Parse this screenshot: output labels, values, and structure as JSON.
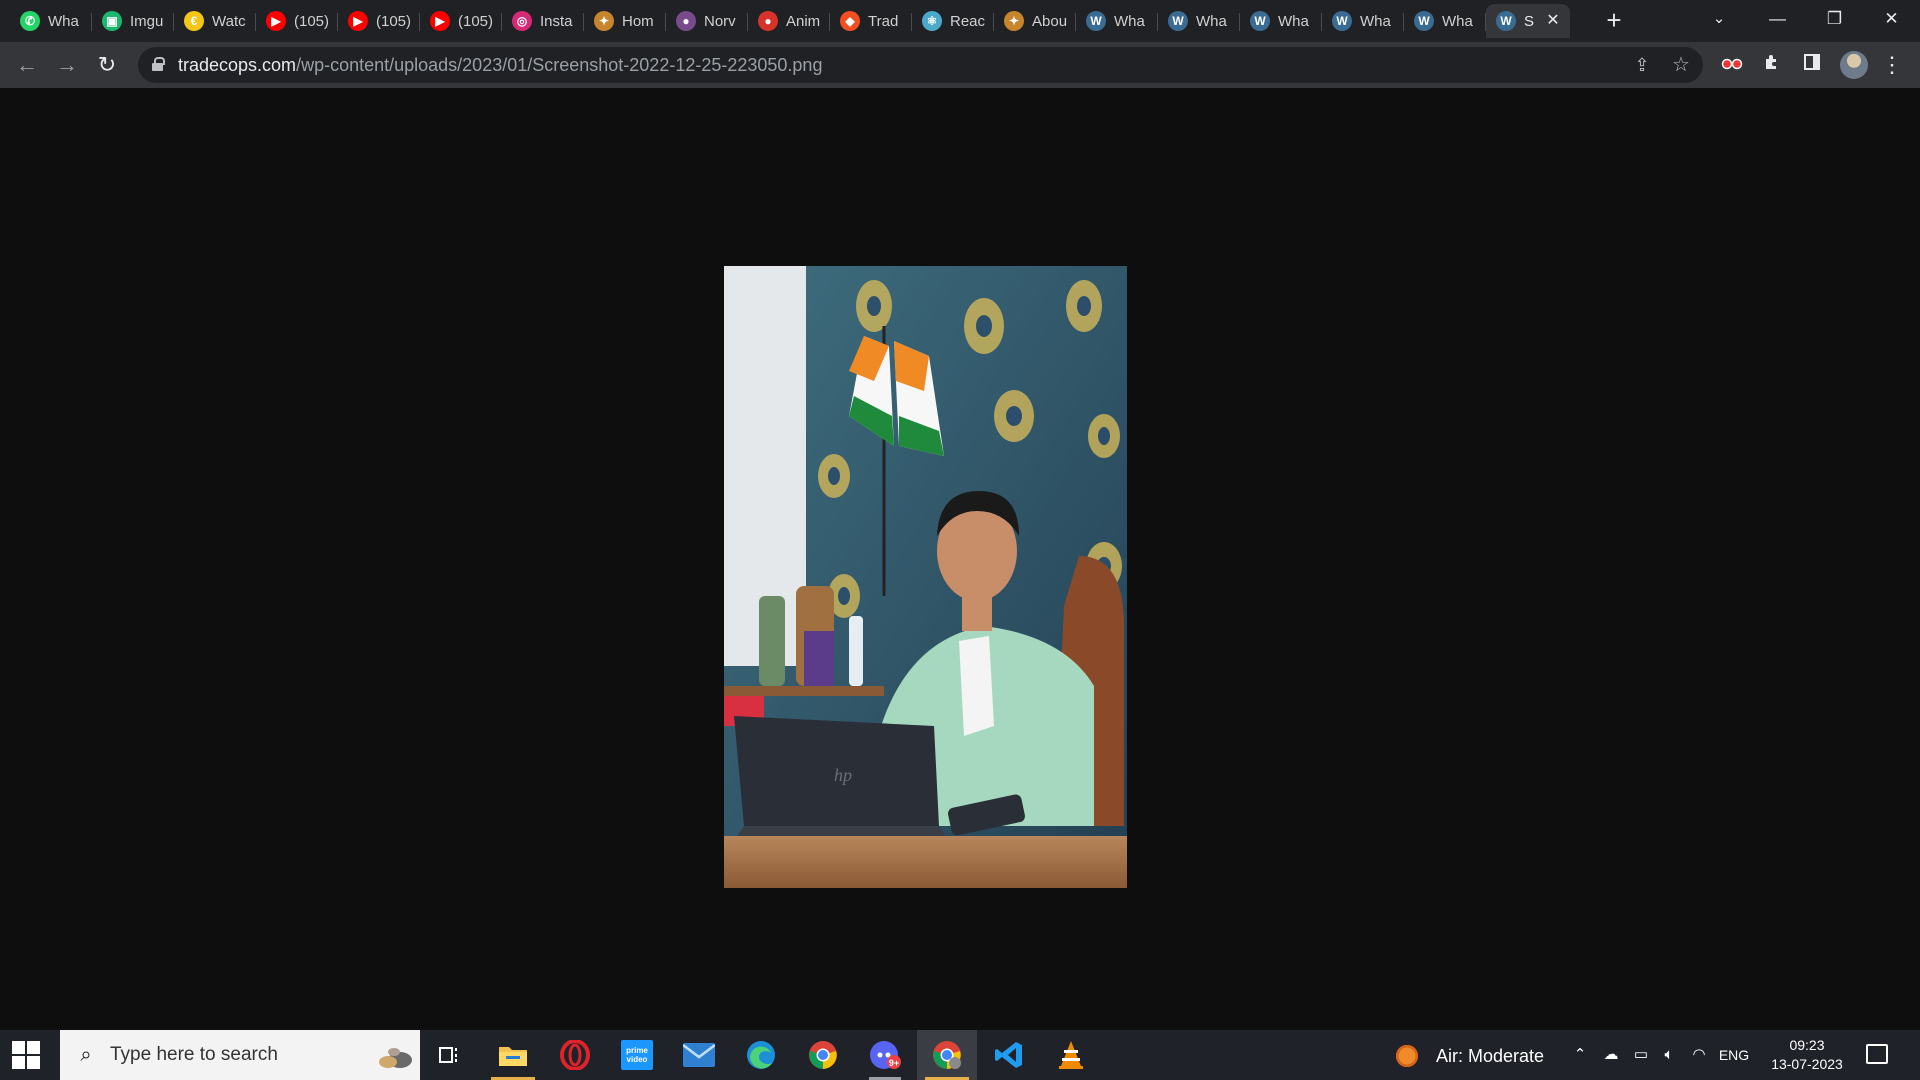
{
  "browser": {
    "tabs": [
      {
        "title": "Wha",
        "icon": "whatsapp-icon",
        "color": "#25D366",
        "glyph": "✆"
      },
      {
        "title": "Imgu",
        "icon": "imgur-icon",
        "color": "#1bb76e",
        "glyph": "▣"
      },
      {
        "title": "Watc",
        "icon": "watcher-icon",
        "color": "#f5c518",
        "glyph": "€"
      },
      {
        "title": "(105)",
        "icon": "youtube-icon",
        "color": "#ff0000",
        "glyph": "▶"
      },
      {
        "title": "(105)",
        "icon": "youtube-icon",
        "color": "#ff0000",
        "glyph": "▶"
      },
      {
        "title": "(105)",
        "icon": "youtube-icon",
        "color": "#ff0000",
        "glyph": "▶"
      },
      {
        "title": "Insta",
        "icon": "instagram-icon",
        "color": "#d62976",
        "glyph": "◎"
      },
      {
        "title": "Hom",
        "icon": "home-site-icon",
        "color": "#c8862c",
        "glyph": "✦"
      },
      {
        "title": "Norv",
        "icon": "norv-icon",
        "color": "#7a4b8c",
        "glyph": "●"
      },
      {
        "title": "Anim",
        "icon": "anime-icon",
        "color": "#d8322b",
        "glyph": "●"
      },
      {
        "title": "Trad",
        "icon": "figma-icon",
        "color": "#f24e1e",
        "glyph": "◆"
      },
      {
        "title": "Reac",
        "icon": "react-icon",
        "color": "#4aa8c8",
        "glyph": "⚛"
      },
      {
        "title": "Abou",
        "icon": "about-site-icon",
        "color": "#c8862c",
        "glyph": "✦"
      },
      {
        "title": "Wha",
        "icon": "wordpress-icon",
        "color": "#3a6b93",
        "glyph": "W"
      },
      {
        "title": "Wha",
        "icon": "wordpress-icon",
        "color": "#3a6b93",
        "glyph": "W"
      },
      {
        "title": "Wha",
        "icon": "wordpress-icon",
        "color": "#3a6b93",
        "glyph": "W"
      },
      {
        "title": "Wha",
        "icon": "wordpress-icon",
        "color": "#3a6b93",
        "glyph": "W"
      },
      {
        "title": "Wha",
        "icon": "wordpress-icon",
        "color": "#3a6b93",
        "glyph": "W"
      },
      {
        "title": "S",
        "icon": "wordpress-icon",
        "color": "#3a6b93",
        "glyph": "W",
        "active": true
      }
    ],
    "new_tab_glyph": "+",
    "tab_search_glyph": "⌄",
    "window": {
      "minimize": "—",
      "restore": "❐",
      "close": "✕"
    },
    "nav": {
      "back": "←",
      "forward": "→",
      "reload": "↻"
    },
    "url": {
      "host": "tradecops.com",
      "path": "/wp-content/uploads/2023/01/Screenshot-2022-12-25-223050.png"
    },
    "toolbar_glyphs": {
      "share": "⇪",
      "bookmark": "☆",
      "extension": "⚙",
      "puzzle": "✚",
      "sidepanel": "▯",
      "menu": "⋮"
    }
  },
  "taskbar": {
    "search_placeholder": "Type here to search",
    "weather": "Air: Moderate",
    "language": "ENG",
    "time": "09:23",
    "date": "13-07-2023",
    "apps": [
      "task-view",
      "file-explorer",
      "opera",
      "prime-video",
      "mail",
      "edge",
      "chrome",
      "discord",
      "chrome-profile",
      "vscode",
      "vlc"
    ]
  }
}
